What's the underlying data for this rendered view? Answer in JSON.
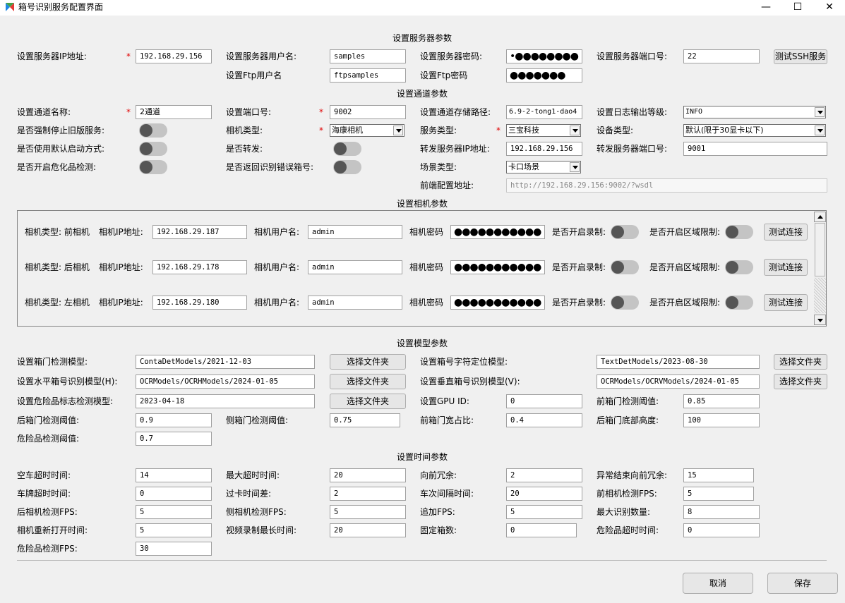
{
  "window": {
    "title": "箱号识别服务配置界面",
    "min_glyph": "—",
    "max_glyph": "☐",
    "close_glyph": "✕",
    "icon": "app-logo-icon"
  },
  "server": {
    "header": "设置服务器参数",
    "ip_label": "设置服务器IP地址:",
    "ip": "192.168.29.156",
    "user_label": "设置服务器用户名:",
    "user": "samples",
    "pwd_label": "设置服务器密码:",
    "pwd": "•●●●●●●●●",
    "port_label": "设置服务器端口号:",
    "port": "22",
    "ssh_button": "测试SSH服务",
    "ftp_user_label": "设置Ftp用户名",
    "ftp_user": "ftpsamples",
    "ftp_pwd_label": "设置Ftp密码",
    "ftp_pwd": "●●●●●●●"
  },
  "channel": {
    "header": "设置通道参数",
    "name_label": "设置通道名称:",
    "name": "2通道",
    "port_label": "设置端口号:",
    "port": "9002",
    "storage_label": "设置通道存储路径:",
    "storage": "6.9-2-tong1-dao4",
    "log_label": "设置日志输出等级:",
    "log_level": "INFO",
    "stop_old_label": "是否强制停止旧版服务:",
    "camera_type_label": "相机类型:",
    "camera_type": "海康相机",
    "service_type_label": "服务类型:",
    "service_type": "三宝科技",
    "device_type_label": "设备类型:",
    "device_type": "默认(限于30显卡以下)",
    "default_start_label": "是否使用默认启动方式:",
    "forward_label": "是否转发:",
    "fwd_ip_label": "转发服务器IP地址:",
    "fwd_ip": "192.168.29.156",
    "fwd_port_label": "转发服务器端口号:",
    "fwd_port": "9001",
    "hazard_label": "是否开启危化品检测:",
    "return_err_label": "是否返回识别错误箱号:",
    "scene_label": "场景类型:",
    "scene": "卡口场景",
    "frontend_label": "前端配置地址:",
    "frontend": "http://192.168.29.156:9002/?wsdl"
  },
  "camera": {
    "header": "设置相机参数",
    "rows": [
      {
        "type_label": "相机类型: 前相机",
        "ip_label": "相机IP地址:",
        "ip": "192.168.29.187",
        "user_label": "相机用户名:",
        "user": "admin",
        "pwd_label": "相机密码",
        "pwd": "●●●●●●●●●●●",
        "record_label": "是否开启录制:",
        "region_label": "是否开启区域限制:",
        "test_button": "测试连接"
      },
      {
        "type_label": "相机类型: 后相机",
        "ip_label": "相机IP地址:",
        "ip": "192.168.29.178",
        "user_label": "相机用户名:",
        "user": "admin",
        "pwd_label": "相机密码",
        "pwd": "●●●●●●●●●●●",
        "record_label": "是否开启录制:",
        "region_label": "是否开启区域限制:",
        "test_button": "测试连接"
      },
      {
        "type_label": "相机类型: 左相机",
        "ip_label": "相机IP地址:",
        "ip": "192.168.29.180",
        "user_label": "相机用户名:",
        "user": "admin",
        "pwd_label": "相机密码",
        "pwd": "●●●●●●●●●●●",
        "record_label": "是否开启录制:",
        "region_label": "是否开启区域限制:",
        "test_button": "测试连接"
      }
    ]
  },
  "model": {
    "header": "设置模型参数",
    "door_label": "设置箱门检测模型:",
    "door": "ContaDetModels/2021-12-03",
    "char_label": "设置箱号字符定位模型:",
    "char": "TextDetModels/2023-08-30",
    "horiz_label": "设置水平箱号识别模型(H):",
    "horiz": "OCRModels/OCRHModels/2024-01-05",
    "vert_label": "设置垂直箱号识别模型(V):",
    "vert": "OCRModels/OCRVModels/2024-01-05",
    "hazard_label": "设置危险品标志检测模型:",
    "hazard": "2023-04-18",
    "gpu_label": "设置GPU ID:",
    "gpu": "0",
    "front_door_th_label": "前箱门检测阈值:",
    "front_door_th": "0.85",
    "back_door_th_label": "后箱门检测阈值:",
    "back_door_th": "0.9",
    "side_door_th_label": "侧箱门检测阈值:",
    "side_door_th": "0.75",
    "front_width_label": "前箱门宽占比:",
    "front_width": "0.4",
    "back_bottom_label": "后箱门底部高度:",
    "back_bottom": "100",
    "hazard_th_label": "危险品检测阈值:",
    "hazard_th": "0.7",
    "folder_button": "选择文件夹"
  },
  "time": {
    "header": "设置时间参数",
    "empty_timeout_label": "空车超时时间:",
    "empty_timeout": "14",
    "max_timeout_label": "最大超时时间:",
    "max_timeout": "20",
    "fwd_redundancy_label": "向前冗余:",
    "fwd_redundancy": "2",
    "abnormal_label": "异常结束向前冗余:",
    "abnormal": "15",
    "plate_timeout_label": "车牌超时时间:",
    "plate_timeout": "0",
    "pass_diff_label": "过卡时间差:",
    "pass_diff": "2",
    "interval_label": "车次间隔时间:",
    "interval": "20",
    "front_fps_label": "前相机检测FPS:",
    "front_fps": "5",
    "back_fps_label": "后相机检测FPS:",
    "back_fps": "5",
    "side_fps_label": "侧相机检测FPS:",
    "side_fps": "5",
    "extra_fps_label": "追加FPS:",
    "extra_fps": "5",
    "max_count_label": "最大识别数量:",
    "max_count": "8",
    "reopen_label": "相机重新打开时间:",
    "reopen": "5",
    "rec_max_label": "视频录制最长时间:",
    "rec_max": "20",
    "fixed_box_label": "固定箱数:",
    "fixed_box": "0",
    "hazard_timeout_label": "危险品超时时间:",
    "hazard_timeout": "0",
    "hazard_fps_label": "危险品检测FPS:",
    "hazard_fps": "30"
  },
  "footer": {
    "cancel": "取消",
    "save": "保存"
  },
  "required_mark": "*",
  "colors": {
    "required": "#e00000",
    "toggle_track": "#c4c4c4",
    "toggle_knob": "#555555",
    "window_bg": "#f0f0f0"
  }
}
